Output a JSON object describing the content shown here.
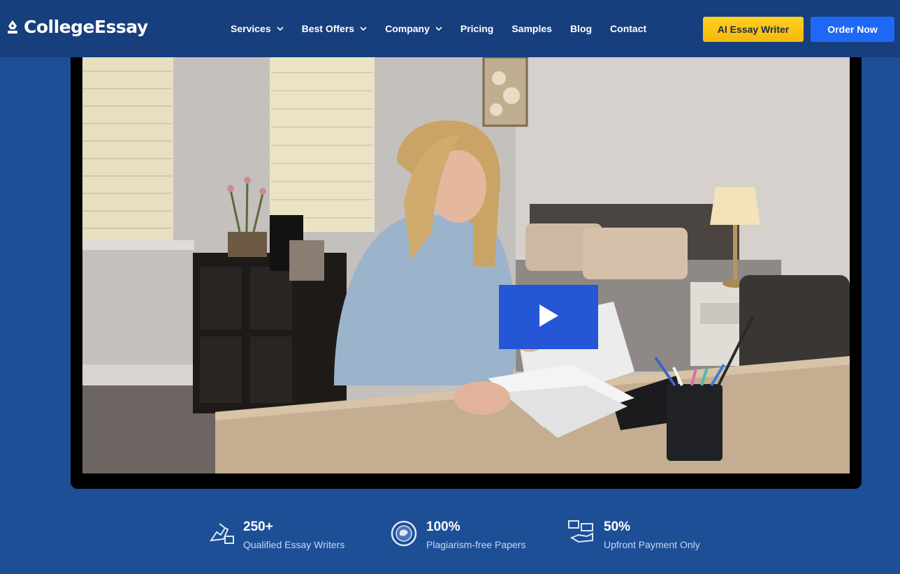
{
  "header": {
    "logo_text": "CollegeEssay",
    "nav": [
      {
        "label": "Services",
        "dropdown": true
      },
      {
        "label": "Best Offers",
        "dropdown": true
      },
      {
        "label": "Company",
        "dropdown": true
      },
      {
        "label": "Pricing",
        "dropdown": false
      },
      {
        "label": "Samples",
        "dropdown": false
      },
      {
        "label": "Blog",
        "dropdown": false
      },
      {
        "label": "Contact",
        "dropdown": false
      }
    ],
    "ai_button_label": "AI Essay Writer",
    "order_button_label": "Order Now"
  },
  "video": {
    "play_icon": "play-icon"
  },
  "stats": [
    {
      "value": "250+",
      "label": "Qualified Essay Writers",
      "icon": "writer-hand-icon"
    },
    {
      "value": "100%",
      "label": "Plagiarism-free Papers",
      "icon": "globe-badge-icon"
    },
    {
      "value": "50%",
      "label": "Upfront Payment Only",
      "icon": "payment-hand-icon"
    }
  ],
  "colors": {
    "background": "#1d4f97",
    "header": "#173f7d",
    "ai_button": "#f8c015",
    "order_button": "#1f68f5",
    "play_button": "#2456d6"
  }
}
